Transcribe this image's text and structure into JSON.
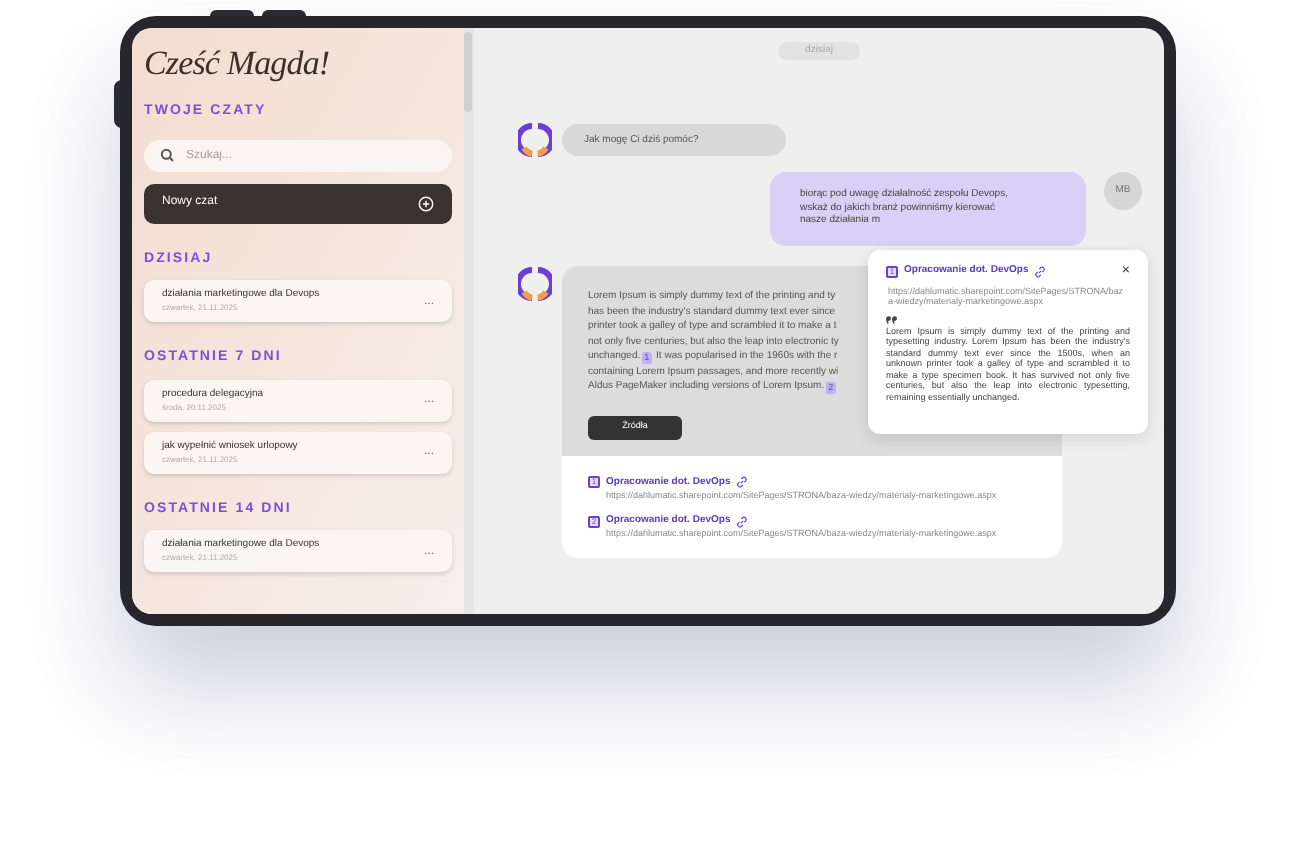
{
  "sidebar": {
    "greeting": "Cześć Magda!",
    "section_title": "TWOJE CZATY",
    "search": {
      "placeholder": "Szukaj..."
    },
    "new_chat": "Nowy czat",
    "groups": [
      {
        "title": "DZISIAJ",
        "chats": [
          {
            "title": "działania marketingowe dla Devops",
            "date": "czwartek, 21.11.2025",
            "menu": "..."
          }
        ]
      },
      {
        "title": "OSTATNIE 7 DNI",
        "chats": [
          {
            "title": "procedura delegacyjna",
            "date": "środa, 20.11.2025",
            "menu": "..."
          },
          {
            "title": "jak wypełnić wniosek urlopowy",
            "date": "czwartek, 21.11.2025",
            "menu": "..."
          }
        ]
      },
      {
        "title": "OSTATNIE 14 DNI",
        "chats": [
          {
            "title": "działania marketingowe dla Devops",
            "date": "czwartek, 21.11.2025",
            "menu": "..."
          }
        ]
      }
    ]
  },
  "chat": {
    "date_divider": "dzisiaj",
    "messages": [
      {
        "kind": "bot",
        "text": "Jak mogę Ci dziś pomóc?"
      },
      {
        "kind": "user",
        "avatar": "MB",
        "lines": [
          "biorąc pod uwagę działalność zespołu Devops,",
          "wskaż do jakich branż powinniśmy kierować",
          "nasze działania m"
        ]
      },
      {
        "kind": "answer",
        "lines": [
          [
            {
              "kind": "text",
              "text": "Lorem Ipsum is simply dummy text of the printing and ty"
            }
          ],
          [
            {
              "kind": "text",
              "text": "has been the industry's standard dummy text ever since"
            }
          ],
          [
            {
              "kind": "text",
              "text": "printer took a galley of type and scrambled it to make a t"
            }
          ],
          [
            {
              "kind": "text",
              "text": "not only five centuries, but also the leap into electronic ty"
            }
          ],
          [
            {
              "kind": "text",
              "text": "unchanged."
            },
            {
              "kind": "cite",
              "text": "1"
            },
            {
              "kind": "text",
              "text": " It was popularised in the 1960s with the r"
            }
          ],
          [
            {
              "kind": "text",
              "text": "containing Lorem Ipsum passages, and more recently wi"
            }
          ],
          [
            {
              "kind": "text",
              "text": "Aldus PageMaker including versions of Lorem Ipsum."
            },
            {
              "kind": "cite",
              "text": "2"
            }
          ]
        ],
        "sources_button": "Źródła",
        "sources": [
          {
            "number": "1",
            "title": "Opracowanie dot. DevOps",
            "url": "https://dahlumatic.sharepoint.com/SitePages/STRONA/baza-wiedzy/materialy-marketingowe.aspx"
          },
          {
            "number": "2",
            "title": "Opracowanie dot. DevOps",
            "url": "https://dahlumatic.sharepoint.com/SitePages/STRONA/baza-wiedzy/materialy-marketingowe.aspx"
          }
        ]
      }
    ]
  },
  "popup": {
    "number": "1",
    "title": "Opracowanie dot. DevOps",
    "close": "×",
    "url": "https://dahlumatic.sharepoint.com/SitePages/STRONA/baza-wiedzy/materialy-marketingowe.aspx",
    "quote": "Lorem Ipsum is simply dummy text of the printing and typesetting industry. Lorem Ipsum has been the industry's standard dummy text ever since the 1500s, when an unknown printer took a galley of type and scrambled it to make a type specimen book. It has survived not only five centuries, but also the leap into electronic typesetting, remaining essentially unchanged."
  }
}
